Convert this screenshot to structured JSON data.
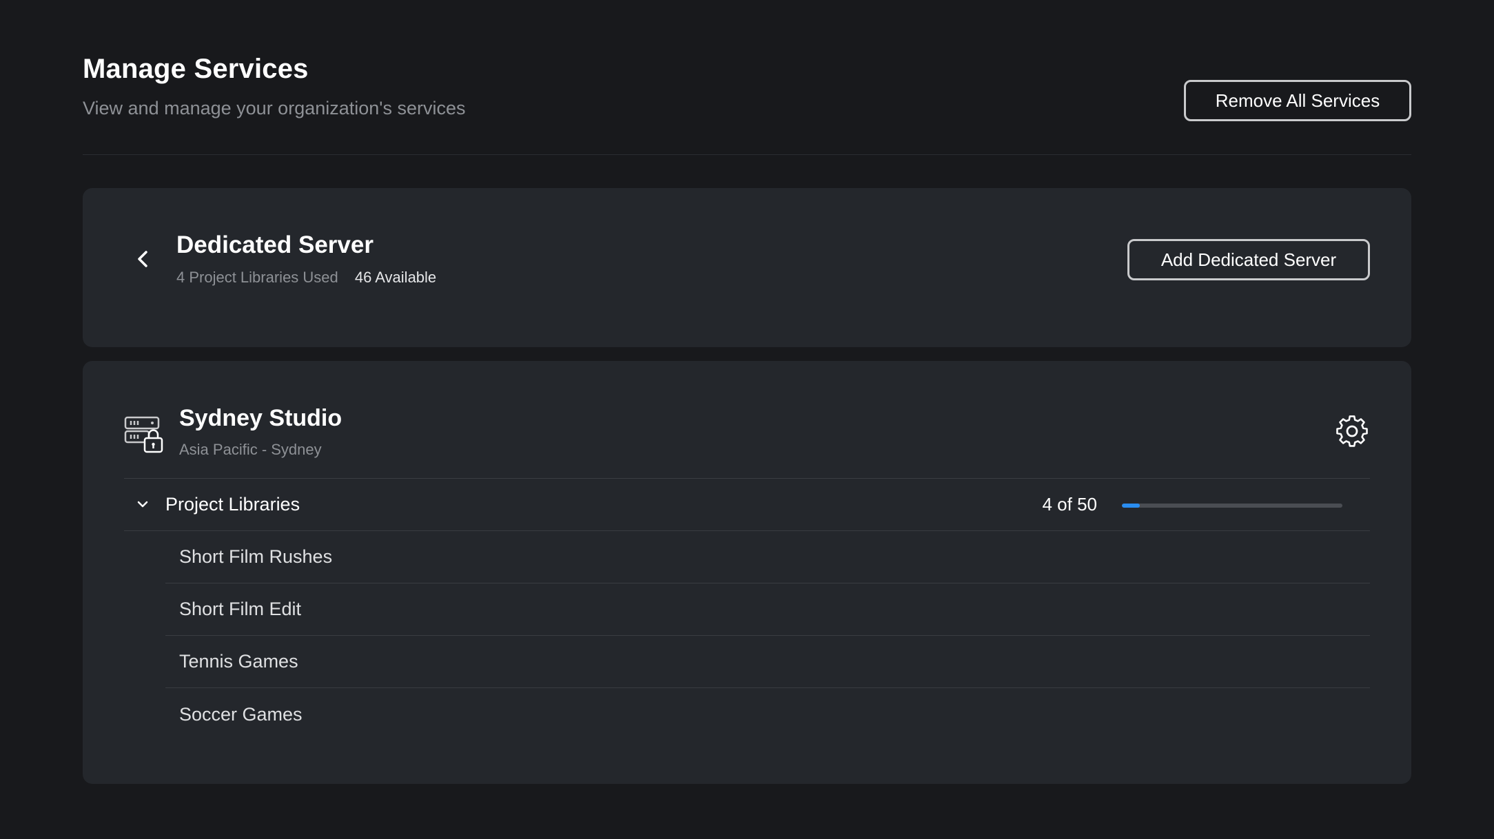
{
  "header": {
    "title": "Manage Services",
    "subtitle": "View and manage your organization's services",
    "remove_all_label": "Remove All Services"
  },
  "service": {
    "title": "Dedicated Server",
    "used": "4 Project Libraries Used",
    "available": "46 Available",
    "add_label": "Add Dedicated Server",
    "back_icon": "chevron-left-icon"
  },
  "studio": {
    "name": "Sydney Studio",
    "region": "Asia Pacific - Sydney",
    "icon": "server-lock-icon",
    "settings_icon": "gear-icon",
    "libraries": {
      "label": "Project Libraries",
      "usage_text": "4 of 50",
      "used": 4,
      "total": 50,
      "items": [
        "Short Film Rushes",
        "Short Film Edit",
        "Tennis Games",
        "Soccer Games"
      ]
    }
  },
  "colors": {
    "background": "#18191c",
    "card": "#24272c",
    "accent": "#2a8df0",
    "muted_text": "#8e9196"
  }
}
